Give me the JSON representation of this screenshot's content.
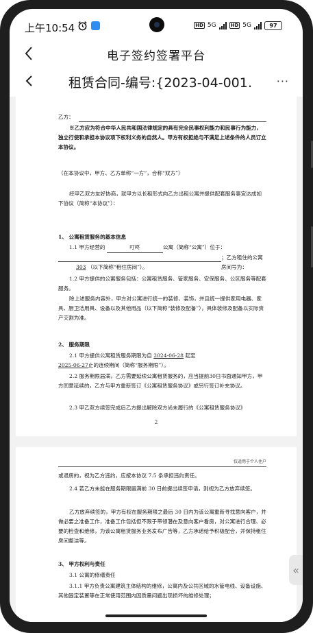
{
  "status_bar": {
    "time": "上午10:54",
    "network1": "5G",
    "network2": "5G",
    "hd": "HD",
    "battery": "97"
  },
  "header": {
    "title": "电子签约签署平台",
    "doc_title": "租赁合同-编号:{2023-04-001…",
    "more": "···"
  },
  "page1": {
    "party_b": "乙方：",
    "notice": "※乙方应为符合中华人民共和国法律规定的具有完全民事权利能力和民事行为能力，独立行使和承担本协议项下权利义务的自然人。甲方有权拒绝与不满足上述条件的人员订立本协议。",
    "abbr": "（在本协议中，甲方、乙方单称“一方”，合称“双方”）",
    "intro": "经甲乙双方友好协商，就甲方以长租形式向乙方出租公寓并提供配套服务事宜达成如下协议（简称“本协议”）：",
    "s1_title": "1、 公寓租赁服务的基本信息",
    "s1_1_a": "1.1 甲方经营的",
    "s1_1_name": "叮咚",
    "s1_1_b": "公寓（简称“公寓”）位于：",
    "s1_1_c": "；乙方租住的公寓房间号为：",
    "s1_1_room": "303",
    "s1_1_d": "（以下简称“租住房间”）。",
    "s1_2": "1.2 甲方提供的公寓服务包括：公寓租赁服务、管家服务、安保服务、公区服务等配套服务。",
    "s1_3": "除上述服务内容外，甲方对公寓进行统一的装修、装饰，并且统一提供家用电器、家具、厨卫洁用具、设备以及其他用品（以下简称“装修及配备”），具体装修及配备以实际资产交割为准。",
    "s2_title": "2、 服务期限",
    "s2_1_a": "2.1 甲方提供公寓租赁服务期限为自",
    "s2_1_start": "2024-06-28",
    "s2_1_b": "起至",
    "s2_1_end": "2025-06-27",
    "s2_1_c": "止的连续期间（简称“服务期限”）。",
    "s2_2": "2.2 服务期限届满，乙方需要延续公寓租赁服务的，应当提前30日书面通知甲方，甲方同意延续的，乙方与甲方重新签订《公寓租赁服务协议》或另行签订补充协议。",
    "s2_3": "2.3 甲乙双方续签完成后乙方提出解除双方尚未履行的《公寓租赁服务协议》",
    "page_no": "2"
  },
  "page2": {
    "header_note": "仅适用于个人住户",
    "p1": "或退房的，视为乙方违约，应按本协议 7.5 条承担违约责任。",
    "p2": "2.4 若乙方未能在服务期限届满前 30 日前提出续签申请，则视为乙方放弃续签。",
    "p3": "乙方放弃续签的，甲方有权在服务期限之最后 30 日内为该公寓重新寻找意向客户，并做必要之准备工作，准备工作包括但不限于带领潜在及意向客户看房，对公寓进行合理、必要的检查和维修，为该公寓租赁服务业务发布广告等，乙方承诺给予积极配合，并保持租住房间整洁等。",
    "s3_title": "3、 甲方权利与责任",
    "s3_1": "3.1 公寓的修缮责任",
    "s3_1_1": "3.1.1 甲方负责公寓建筑主体结构的维修，公寓内及公共区域的水管电线、设备设施、其他固定装置等在正常使用范围内因质量问题出现损坏的维修处理；"
  },
  "icons": {
    "back": "back-arrow-icon",
    "alarm": "alarm-clock-icon",
    "collapse": "double-chevron-left-icon"
  }
}
